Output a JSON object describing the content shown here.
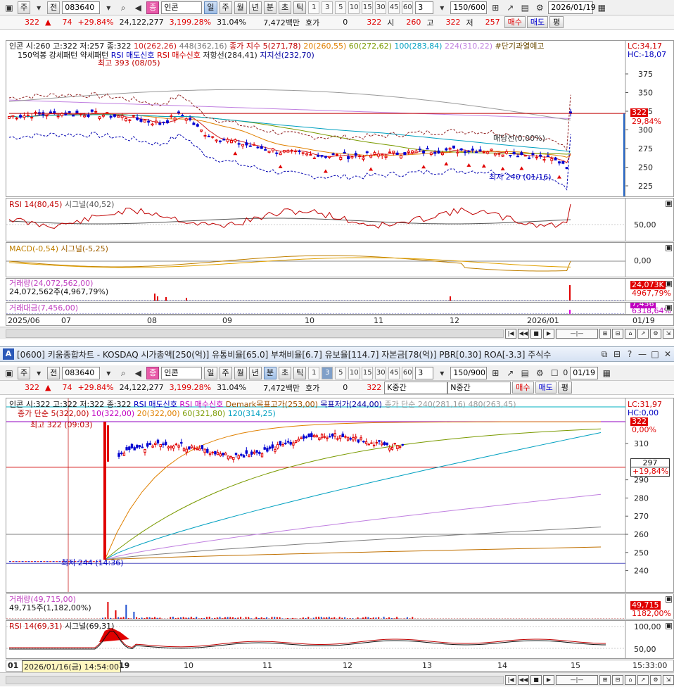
{
  "top": {
    "toolbar": {
      "type_label": "주",
      "scope_label": "전",
      "code": "083640",
      "name_prefix": "종",
      "name": "인콘",
      "periods": [
        "일",
        "주",
        "월",
        "년",
        "분",
        "초",
        "틱"
      ],
      "active_period": "일",
      "numbers": [
        "1",
        "3",
        "5",
        "10",
        "15",
        "30",
        "45",
        "60"
      ],
      "count_select": "3",
      "range": "150/600",
      "date": "2026/01/19"
    },
    "quote": {
      "price": "322",
      "change": "74",
      "change_pct": "+29.84%",
      "volume": "24,122,277",
      "vol_pct": "3,199.28%",
      "turnover": "31.04%",
      "amount": "7,472백만",
      "bid_label": "호가",
      "bid_value": "0",
      "bid_price": "322",
      "open_label": "시",
      "open": "260",
      "high_label": "고",
      "high": "322",
      "low_label": "저",
      "low": "257",
      "buy_label": "매수",
      "sell_label": "매도",
      "eval_label": "평"
    },
    "legend_line1": {
      "stock": "인콘 시:260 고:322 저:257 종:322",
      "ma10": "10(262,26)",
      "ma448": "448(362,16)",
      "close_idx": "종가 지수 5(271,78)",
      "ma20": "20(260,55)",
      "ma60": "60(272,62)",
      "ma100": "100(283,84)",
      "ma224": "224(310,22)",
      "short_over": "#단기과열예고"
    },
    "legend_line2": {
      "strong": "150억봉 강세패턴",
      "weak": "약세패턴",
      "rsi_sell": "RSI 매도신호",
      "rsi_buy": "RSI 매수신호",
      "resistance": "저항선(284,41)",
      "support": "지지선(232,70)"
    },
    "lc": "LC:34,17",
    "hc": "HC:-18,07",
    "high_marker": "최고 393 (08/05)",
    "low_marker": "최저 240 (01/16)",
    "bond_marker": "매당선(0,00%)",
    "price_axis": [
      "375",
      "350",
      "325",
      "300",
      "275",
      "250",
      "225"
    ],
    "current_tag": "322",
    "current_pct": "29,84%",
    "rsi_legend": "RSI 14(80,45)",
    "rsi_signal": "시그널(40,52)",
    "rsi_axis": "50,00",
    "macd_legend": "MACD(-0,54)",
    "macd_signal": "시그널(-5,25)",
    "macd_axis": "0,00",
    "vol_legend": "거래량(24,072,562,00)",
    "vol_sub": "24,072,562주(4,967,79%)",
    "vol_tag": "24,073K",
    "vol_tag_pct": "4967,79%",
    "amt_legend": "거래대금(7,456,00)",
    "amt_tag": "7,456",
    "amt_tag_pct": "6318,64%",
    "x_ticks": [
      "2025/06",
      "07",
      "08",
      "09",
      "10",
      "11",
      "12",
      "2026/01"
    ],
    "x_end": "01/19"
  },
  "window": {
    "badge": "A",
    "title": "[0600] 키움종합차트 - KOSDAQ 시가총액[250(억)] 유통비율[65.0] 부채비율[6.7] 유보율[114.7] 자본금[78(억)] PBR[0.30] ROA[-3.3] 주식수"
  },
  "bottom": {
    "toolbar": {
      "type_label": "주",
      "scope_label": "전",
      "code": "083640",
      "name_prefix": "종",
      "name": "인콘",
      "periods": [
        "일",
        "주",
        "월",
        "년",
        "분",
        "초",
        "틱"
      ],
      "active_period": "분",
      "numbers": [
        "1",
        "3",
        "5",
        "10",
        "15",
        "30",
        "45",
        "60"
      ],
      "active_number": "3",
      "count_select": "3",
      "range": "150/900",
      "checkbox_value": "0",
      "date": "01/19"
    },
    "quote": {
      "price": "322",
      "change": "74",
      "change_pct": "+29.84%",
      "volume": "24,122,277",
      "vol_pct": "3,199.28%",
      "turnover": "31.04%",
      "amount": "7,472백만",
      "bid_label": "호가",
      "bid_value": "0",
      "bid_price": "322",
      "k_mid": "K중간",
      "n_mid": "N중간",
      "buy_label": "매수",
      "sell_label": "매도",
      "eval_label": "평"
    },
    "legend_line1": {
      "stock": "인콘 시:322 고:322 저:322 종:322",
      "rsi_sell": "RSI 매도신호",
      "rsi_buy": "RSI 매수신호",
      "demark_high": "Demark목표고가(253,00)",
      "demark_low": "목표저가(244,00)",
      "close_simple": "종가 단순 240(281,16)",
      "ma480": "480(263,45)"
    },
    "legend_line2": {
      "close_simple5": "종가 단순 5(322,00)",
      "ma10": "10(322,00)",
      "ma20": "20(322,00)",
      "ma60": "60(321,80)",
      "ma120": "120(314,25)"
    },
    "lc": "LC:31,97",
    "hc": "HC:0,00",
    "high_marker": "최고 322 (09:03)",
    "low_marker": "최저 244 (14:36)",
    "price_axis": [
      "310",
      "290",
      "280",
      "270",
      "260",
      "250",
      "240"
    ],
    "top_tag": "322",
    "top_tag_pct": "0,00%",
    "cursor_tag": "297",
    "cursor_pct": "+19,84%",
    "vol_legend": "거래량(49,715,00)",
    "vol_sub": "49,715주(1,182,00%)",
    "vol_tag": "49,715",
    "vol_tag_pct": "1182,00%",
    "rsi_legend": "RSI 14(69,31)",
    "rsi_signal": "시그널(69,31)",
    "rsi_axis_top": "100,00",
    "rsi_axis_mid": "50,00",
    "x_start": "01",
    "cursor_date": "2026/01/16(금) 14:54:00",
    "x_ticks": [
      "19",
      "10",
      "11",
      "12",
      "13",
      "14",
      "15"
    ],
    "x_end": "15:33:00"
  }
}
